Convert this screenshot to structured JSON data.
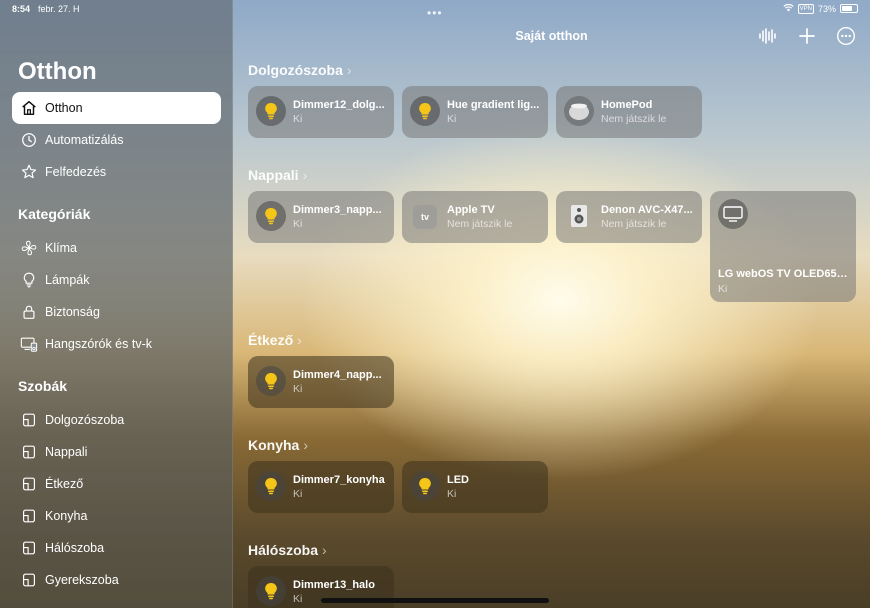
{
  "status": {
    "time": "8:54",
    "date": "febr. 27. H",
    "vpn": "VPN",
    "battery": "73%",
    "battery_level": 0.73
  },
  "sidebar": {
    "title": "Otthon",
    "main_items": [
      {
        "label": "Otthon",
        "icon": "house-icon"
      },
      {
        "label": "Automatizálás",
        "icon": "clock-check-icon"
      },
      {
        "label": "Felfedezés",
        "icon": "star-icon"
      }
    ],
    "categories_title": "Kategóriák",
    "categories": [
      {
        "label": "Klíma",
        "icon": "fan-icon"
      },
      {
        "label": "Lámpák",
        "icon": "lightbulb-icon"
      },
      {
        "label": "Biztonság",
        "icon": "lock-icon"
      },
      {
        "label": "Hangszórók és tv-k",
        "icon": "tv-speaker-icon"
      }
    ],
    "rooms_title": "Szobák",
    "rooms": [
      {
        "label": "Dolgozószoba"
      },
      {
        "label": "Nappali"
      },
      {
        "label": "Étkező"
      },
      {
        "label": "Konyha"
      },
      {
        "label": "Hálószoba"
      },
      {
        "label": "Gyerekszoba"
      }
    ]
  },
  "header": {
    "title": "Saját otthon",
    "dots": "•••"
  },
  "rooms": [
    {
      "name": "Dolgozószoba",
      "tiles": [
        {
          "name": "Dimmer12_dolg...",
          "status": "Ki",
          "icon": "lightbulb-icon"
        },
        {
          "name": "Hue gradient lig...",
          "status": "Ki",
          "icon": "lightbulb-icon"
        },
        {
          "name": "HomePod",
          "status": "Nem játszik le",
          "icon": "homepod-icon"
        }
      ]
    },
    {
      "name": "Nappali",
      "tiles": [
        {
          "name": "Dimmer3_napp...",
          "status": "Ki",
          "icon": "lightbulb-icon"
        },
        {
          "name": "Apple TV",
          "status": "Nem játszik le",
          "icon": "apple-tv-icon",
          "icon_text": "tv"
        },
        {
          "name": "Denon AVC-X47...",
          "status": "Nem játszik le",
          "icon": "speaker-icon"
        },
        {
          "name": "LG webOS TV OLED65C...",
          "status": "Ki",
          "icon": "tv-icon"
        }
      ]
    },
    {
      "name": "Étkező",
      "tiles": [
        {
          "name": "Dimmer4_napp...",
          "status": "Ki",
          "icon": "lightbulb-icon"
        }
      ]
    },
    {
      "name": "Konyha",
      "tiles": [
        {
          "name": "Dimmer7_konyha",
          "status": "Ki",
          "icon": "lightbulb-icon"
        },
        {
          "name": "LED",
          "status": "Ki",
          "icon": "lightbulb-icon"
        }
      ]
    },
    {
      "name": "Hálószoba",
      "tiles": [
        {
          "name": "Dimmer13_halo",
          "status": "Ki",
          "icon": "lightbulb-icon"
        }
      ]
    }
  ],
  "colors": {
    "bulb": "#f5c518",
    "active_bg": "#ffffff"
  }
}
